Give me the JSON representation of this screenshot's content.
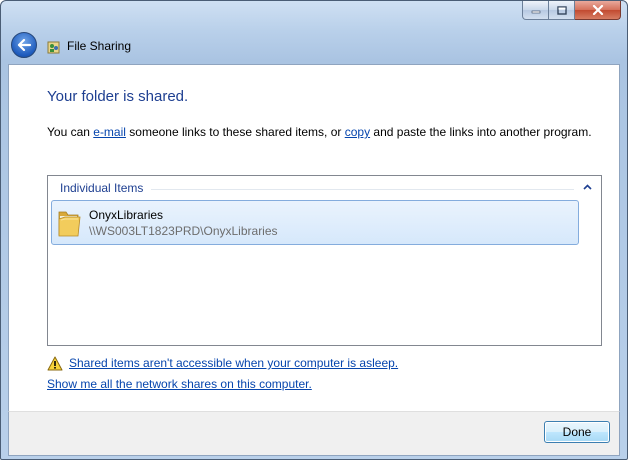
{
  "window": {
    "nav_title": "File Sharing",
    "caption_buttons": [
      "minimize",
      "maximize",
      "close"
    ]
  },
  "main": {
    "heading": "Your folder is shared.",
    "desc_prefix": "You can ",
    "email_link": "e-mail",
    "desc_middle": " someone links to these shared items, or ",
    "copy_link": "copy",
    "desc_suffix": " and paste the links into another program."
  },
  "list": {
    "group_label": "Individual Items",
    "items": [
      {
        "name": "OnyxLibraries",
        "path": "\\\\WS003LT1823PRD\\OnyxLibraries",
        "icon": "folder-icon"
      }
    ]
  },
  "links": {
    "warning": "Shared items aren't accessible when your computer is asleep.",
    "network": "Show me all the network shares on this computer."
  },
  "footer": {
    "done_label": "Done"
  },
  "colors": {
    "heading": "#1e3f91",
    "link": "#0645ad",
    "selection": "#d6e8fb"
  }
}
